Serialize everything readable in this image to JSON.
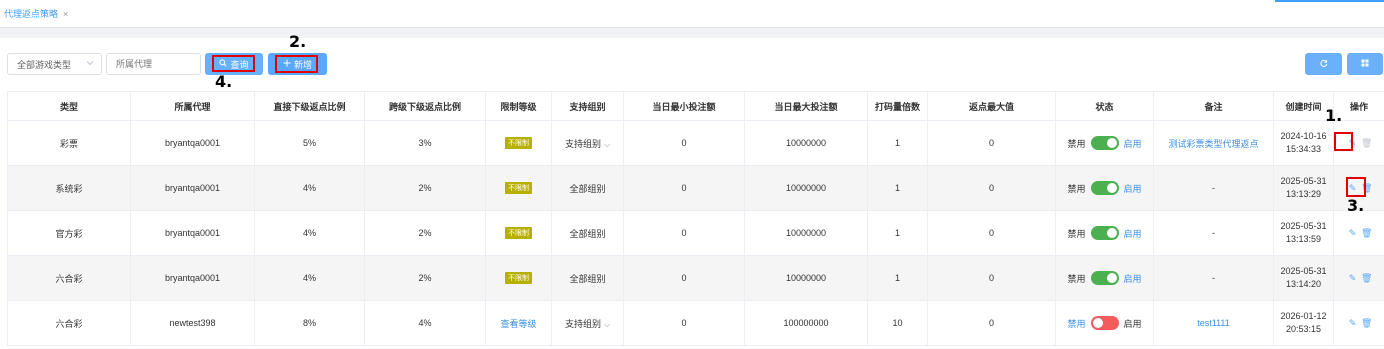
{
  "tab": {
    "title": "代理返点策略",
    "close": "×"
  },
  "toolbar": {
    "game_type_select": "全部游戏类型",
    "agent_placeholder": "所属代理",
    "query_label": "查询",
    "add_label": "新增"
  },
  "annotations": {
    "a1": "1.",
    "a2": "2.",
    "a3": "3.",
    "a4": "4."
  },
  "table": {
    "headers": [
      "类型",
      "所属代理",
      "直接下级返点比例",
      "跨级下级返点比例",
      "限制等级",
      "支持组别",
      "当日最小投注额",
      "当日最大投注额",
      "打码量倍数",
      "返点最大值",
      "状态",
      "备注",
      "创建时间",
      "操作"
    ],
    "rows": [
      {
        "type": "彩票",
        "agent": "bryantqa0001",
        "direct": "5%",
        "cross": "3%",
        "limit": "不限制",
        "group": "支持组别",
        "min": "0",
        "max": "10000000",
        "mult": "1",
        "rmax": "0",
        "off": "禁用",
        "on": "启用",
        "enabled": true,
        "note": "测试彩票类型代理返点",
        "date": "2024-10-16",
        "time": "15:34:33"
      },
      {
        "type": "系统彩",
        "agent": "bryantqa0001",
        "direct": "4%",
        "cross": "2%",
        "limit": "不限制",
        "group": "全部组别",
        "min": "0",
        "max": "10000000",
        "mult": "1",
        "rmax": "0",
        "off": "禁用",
        "on": "启用",
        "enabled": true,
        "note": "-",
        "date": "2025-05-31",
        "time": "13:13:29"
      },
      {
        "type": "官方彩",
        "agent": "bryantqa0001",
        "direct": "4%",
        "cross": "2%",
        "limit": "不限制",
        "group": "全部组别",
        "min": "0",
        "max": "10000000",
        "mult": "1",
        "rmax": "0",
        "off": "禁用",
        "on": "启用",
        "enabled": true,
        "note": "-",
        "date": "2025-05-31",
        "time": "13:13:59"
      },
      {
        "type": "六合彩",
        "agent": "bryantqa0001",
        "direct": "4%",
        "cross": "2%",
        "limit": "不限制",
        "group": "全部组别",
        "min": "0",
        "max": "10000000",
        "mult": "1",
        "rmax": "0",
        "off": "禁用",
        "on": "启用",
        "enabled": true,
        "note": "-",
        "date": "2025-05-31",
        "time": "13:14:20"
      },
      {
        "type": "六合彩",
        "agent": "newtest398",
        "direct": "8%",
        "cross": "4%",
        "limit": "查看等级",
        "group": "支持组别",
        "min": "0",
        "max": "100000000",
        "mult": "10",
        "rmax": "0",
        "off": "禁用",
        "on": "启用",
        "enabled": false,
        "note": "test1111",
        "date": "2026-01-12",
        "time": "20:53:15"
      }
    ]
  },
  "icons": {
    "edit": "edit-icon",
    "delete": "delete-icon",
    "search": "search-icon",
    "plus": "plus-icon",
    "refresh": "refresh-icon",
    "grid": "grid-icon"
  }
}
